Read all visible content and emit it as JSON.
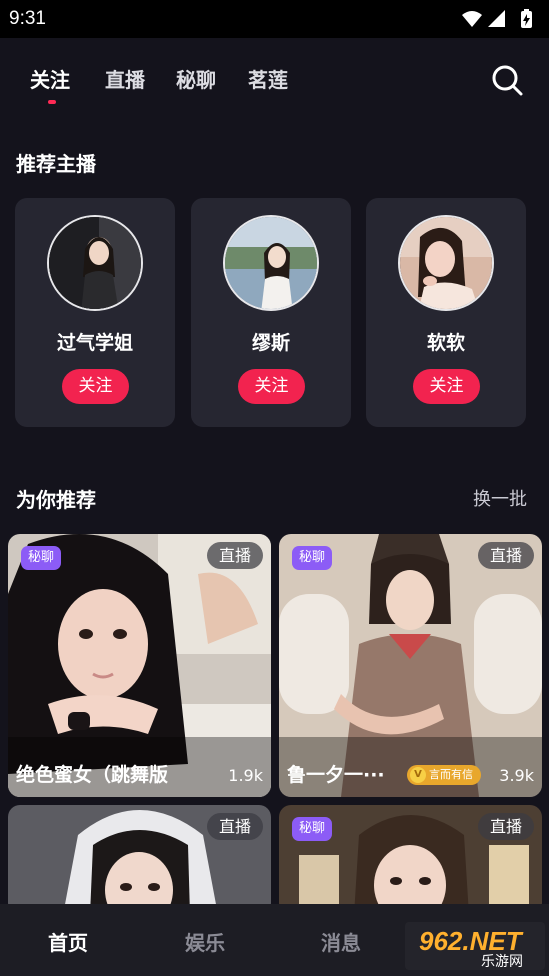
{
  "status_bar": {
    "time": "9:31",
    "icons": [
      "wifi-icon",
      "signal-icon",
      "battery-icon"
    ]
  },
  "top_tabs": [
    {
      "label": "关注",
      "active": true
    },
    {
      "label": "直播",
      "active": false
    },
    {
      "label": "秘聊",
      "active": false
    },
    {
      "label": "茗莲",
      "active": false
    }
  ],
  "recommended_anchors": {
    "title": "推荐主播",
    "items": [
      {
        "name": "过气学姐",
        "follow_label": "关注"
      },
      {
        "name": "缪斯",
        "follow_label": "关注"
      },
      {
        "name": "软软",
        "follow_label": "关注"
      }
    ]
  },
  "for_you": {
    "title": "为你推荐",
    "refresh_label": "换一批",
    "cards": [
      {
        "secret_badge": "秘聊",
        "live_badge": "直播",
        "title": "绝色蜜女（跳舞版",
        "count": "1.9k"
      },
      {
        "secret_badge": "秘聊",
        "live_badge": "直播",
        "title": "鲁一夕一···",
        "tag": "言而有信",
        "tag_icon": "V",
        "count": "3.9k"
      },
      {
        "live_badge": "直播"
      },
      {
        "secret_badge": "秘聊",
        "live_badge": "直播"
      }
    ]
  },
  "bottom_nav": [
    {
      "label": "首页",
      "active": true
    },
    {
      "label": "娱乐",
      "active": false
    },
    {
      "label": "消息",
      "active": false
    }
  ],
  "watermark": {
    "big": "962.NET",
    "small": "乐游网"
  },
  "colors": {
    "accent": "#f2234f",
    "background": "#14131c",
    "card": "#262631",
    "secret_badge": "#8c5cf6"
  }
}
